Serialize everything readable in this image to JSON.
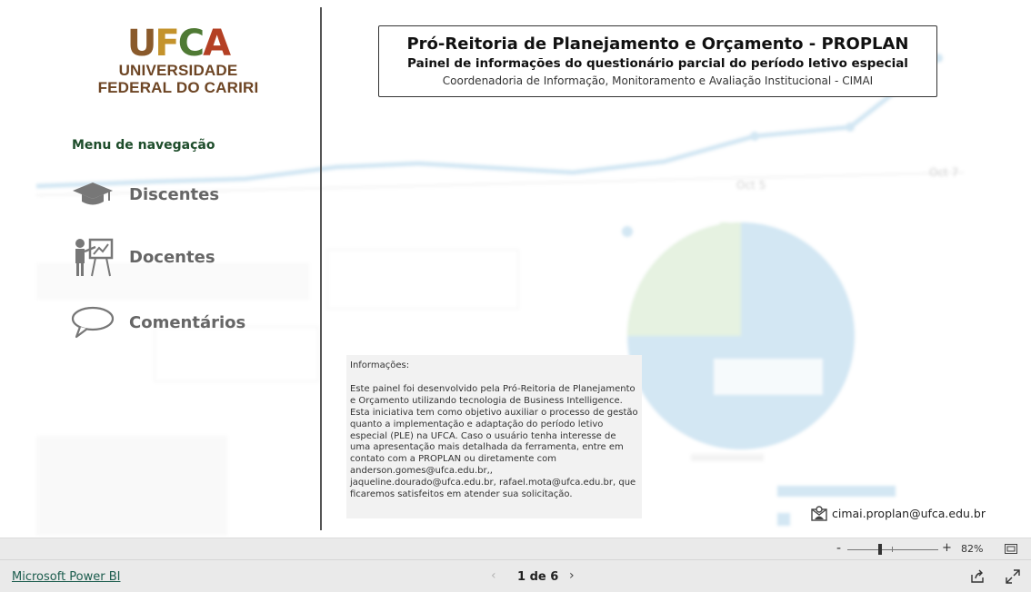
{
  "logo": {
    "mark_letters": [
      "U",
      "F",
      "C",
      "A"
    ],
    "mark_colors": [
      "#8a5a2b",
      "#c4932c",
      "#4f7a34",
      "#b44024"
    ],
    "line1": "UNIVERSIDADE",
    "line2": "FEDERAL DO CARIRI",
    "text_color": "#6d4524"
  },
  "nav": {
    "heading": "Menu de navegação",
    "items": [
      {
        "label": "Discentes",
        "icon": "graduation-cap-icon"
      },
      {
        "label": "Docentes",
        "icon": "teacher-board-icon"
      },
      {
        "label": "Comentários",
        "icon": "speech-bubble-icon"
      }
    ]
  },
  "header": {
    "title": "Pró-Reitoria de Planejamento e Orçamento - PROPLAN",
    "subtitle": "Painel de informações do questionário parcial do período letivo especial",
    "department": "Coordenadoria de Informação, Monitoramento e Avaliação Institucional - CIMAI"
  },
  "info": {
    "heading": "Informações:",
    "body": "Este painel foi desenvolvido pela Pró-Reitoria de Planejamento e Orçamento utilizando tecnologia de Business Intelligence. Esta iniciativa tem como objetivo auxiliar o processo de gestão quanto a implementação e adaptação do período letivo especial (PLE) na UFCA. Caso o usuário tenha interesse de uma apresentação mais detalhada da ferramenta, entre em contato com a PROPLAN ou diretamente com anderson.gomes@ufca.edu.br,, jaqueline.dourado@ufca.edu.br, rafael.mota@ufca.edu.br, que ficaremos satisfeitos em atender sua solicitação."
  },
  "contact": {
    "email": "cimai.proplan@ufca.edu.br",
    "icon": "envelope-person-icon"
  },
  "background_illustration": {
    "axis_labels": [
      "Oct 5",
      "Oct 7"
    ],
    "accent": "#9fcbe6",
    "secondary": "#c8e3bd"
  },
  "zoom": {
    "level": "82%",
    "minus": "-",
    "plus": "+",
    "fraction": 0.36
  },
  "footer": {
    "brand": "Microsoft Power BI",
    "page_indicator": "1 de 6",
    "prev": "‹",
    "next": "›"
  }
}
